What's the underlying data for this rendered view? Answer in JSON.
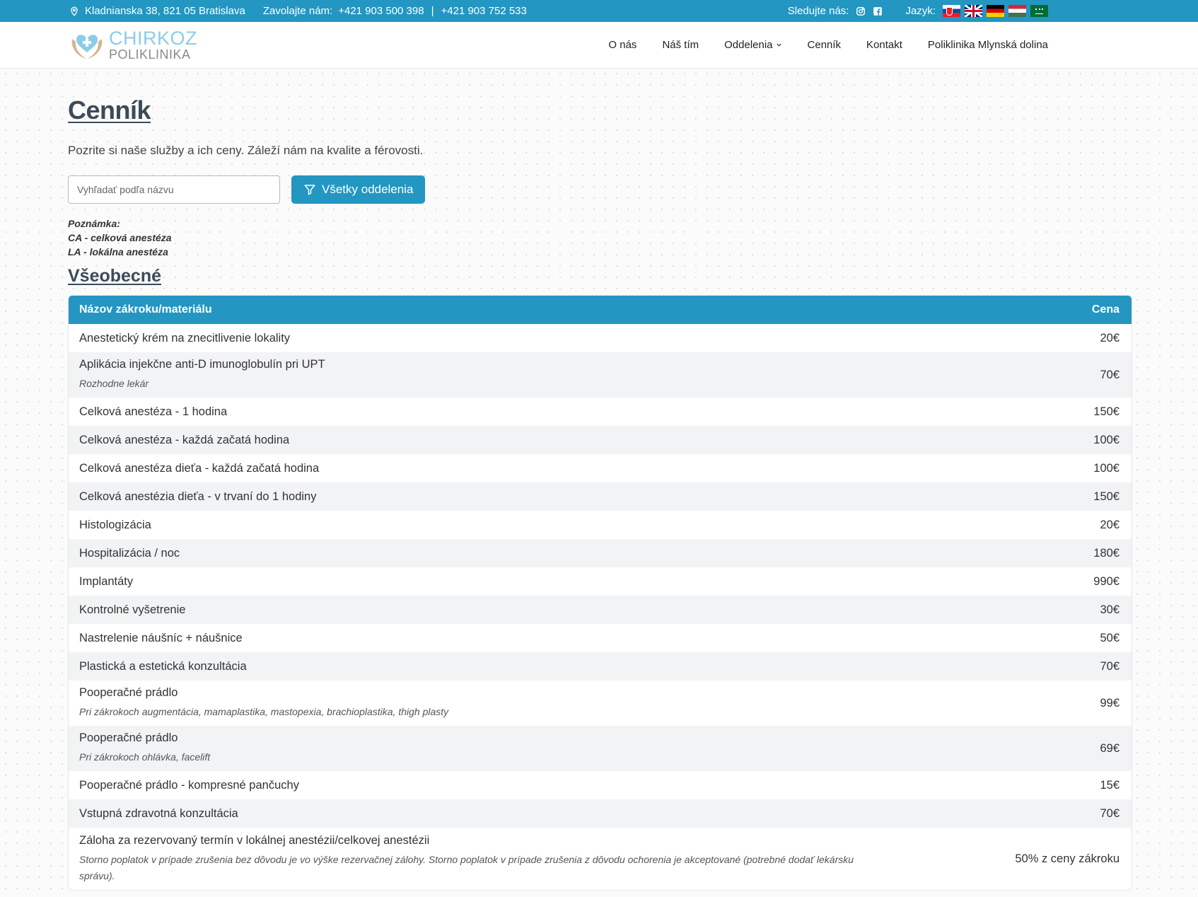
{
  "topbar": {
    "address": "Kladnianska 38, 821 05 Bratislava",
    "call_label": "Zavolajte nám:",
    "phone1": "+421 903 500 398",
    "separator": "|",
    "phone2": "+421 903 752 533",
    "follow_label": "Sledujte nás:",
    "language_label": "Jazyk:",
    "color": "#2396c2"
  },
  "logo": {
    "line1": "CHIRKOZ",
    "line2": "POLIKLINIKA"
  },
  "nav": {
    "about": "O nás",
    "team": "Náš tím",
    "departments": "Oddelenia",
    "pricing": "Cenník",
    "contact": "Kontakt",
    "polyclinic": "Poliklinika Mlynská dolina"
  },
  "page": {
    "title": "Cenník",
    "subtitle": "Pozrite si naše služby a ich ceny. Záleží nám na kvalite a férovosti."
  },
  "search": {
    "placeholder": "Vyhľadať podľa názvu"
  },
  "filter_button": {
    "label": "Všetky oddelenia"
  },
  "note": {
    "label": "Poznámka:",
    "ca": "CA - celková anestéza",
    "la": "LA - lokálna anestéza"
  },
  "section": {
    "title": "Všeobecné"
  },
  "table": {
    "header_name": "Názov zákroku/materiálu",
    "header_price": "Cena",
    "rows": [
      {
        "name": "Anestetický krém na znecitlivenie lokality",
        "sub": "",
        "price": "20€"
      },
      {
        "name": "Aplikácia injekčne anti-D imunoglobulín pri UPT",
        "sub": "Rozhodne lekár",
        "price": "70€"
      },
      {
        "name": "Celková anestéza - 1 hodina",
        "sub": "",
        "price": "150€"
      },
      {
        "name": "Celková anestéza - každá začatá hodina",
        "sub": "",
        "price": "100€"
      },
      {
        "name": "Celková anestéza dieťa - každá začatá hodina",
        "sub": "",
        "price": "100€"
      },
      {
        "name": "Celková anestézia dieťa - v trvaní do 1 hodiny",
        "sub": "",
        "price": "150€"
      },
      {
        "name": "Histologizácia",
        "sub": "",
        "price": "20€"
      },
      {
        "name": "Hospitalizácia / noc",
        "sub": "",
        "price": "180€"
      },
      {
        "name": "Implantáty",
        "sub": "",
        "price": "990€"
      },
      {
        "name": "Kontrolné vyšetrenie",
        "sub": "",
        "price": "30€"
      },
      {
        "name": "Nastrelenie náušníc + náušnice",
        "sub": "",
        "price": "50€"
      },
      {
        "name": "Plastická a estetická konzultácia",
        "sub": "",
        "price": "70€"
      },
      {
        "name": "Pooperačné prádlo",
        "sub": "Pri zákrokoch augmentácia, mamaplastika, mastopexia, brachioplastika, thigh plasty",
        "price": "99€"
      },
      {
        "name": "Pooperačné prádlo",
        "sub": "Pri zákrokoch ohlávka, facelift",
        "price": "69€"
      },
      {
        "name": "Pooperačné prádlo - kompresné pančuchy",
        "sub": "",
        "price": "15€"
      },
      {
        "name": "Vstupná zdravotná konzultácia",
        "sub": "",
        "price": "70€"
      },
      {
        "name": "Záloha za rezervovaný termín v lokálnej anestézii/celkovej anestézii",
        "sub": "Storno poplatok v prípade zrušenia bez dôvodu je vo výške rezervačnej zálohy. Storno poplatok v prípade zrušenia z dôvodu ochorenia je akceptované (potrebné dodať lekársku správu).",
        "price": "50% z ceny zákroku"
      }
    ]
  }
}
